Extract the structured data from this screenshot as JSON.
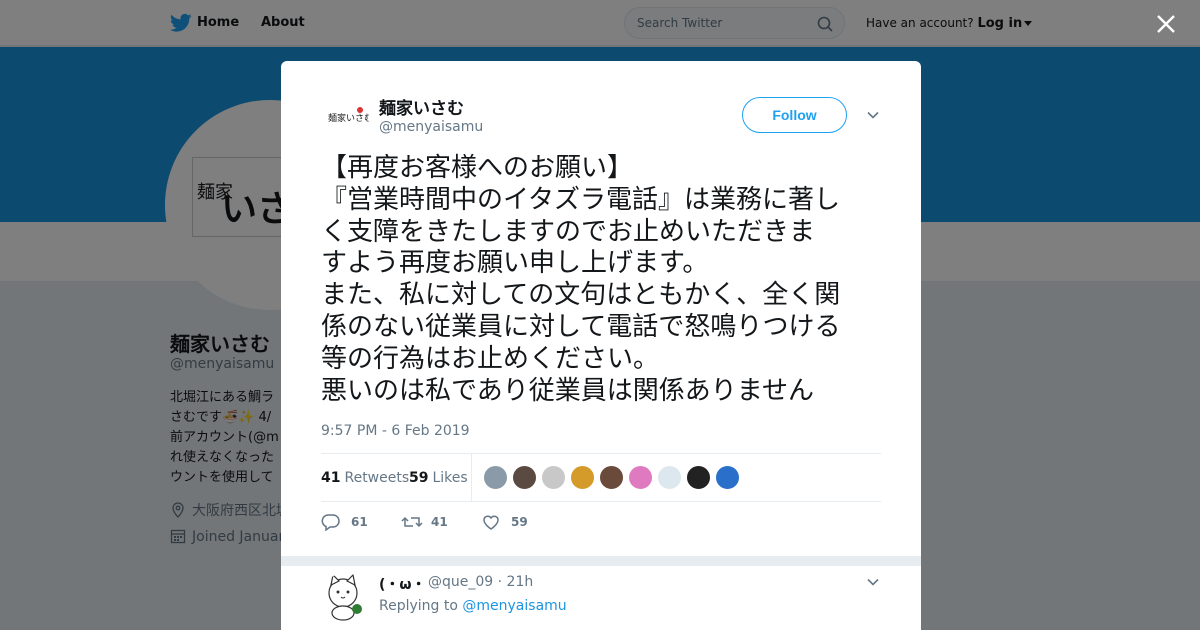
{
  "nav": {
    "home": "Home",
    "about": "About",
    "search_placeholder": "Search Twitter",
    "account_prompt": "Have an account?",
    "login": "Log in"
  },
  "profile": {
    "avatar_text_small": "麺家",
    "avatar_text_large": "いさ",
    "name": "麺家いさむ",
    "handle": "@menyaisamu",
    "bio_lines": [
      "北堀江にある鯛ラ",
      "さむです🍜✨ 4/",
      "前アカウント(@m",
      "れ使えなくなった",
      "ウントを使用して"
    ],
    "bio_mention": "@m",
    "location": "大阪府西区北堀",
    "joined": "Joined Januar"
  },
  "tweet": {
    "name": "麺家いさむ",
    "handle": "@menyaisamu",
    "follow": "Follow",
    "text_lines": [
      "【再度お客様へのお願い】",
      "『営業時間中のイタズラ電話』は業務に著し",
      "く支障をきたしますのでお止めいただきま",
      "すよう再度お願い申し上げます。",
      "また、私に対しての文句はともかく、全く関",
      "係のない従業員に対して電話で怒鳴りつける",
      "等の行為はお止めください。",
      "悪いのは私であり従業員は関係ありません"
    ],
    "timestamp": "9:57 PM - 6 Feb 2019",
    "retweets_count": "41",
    "retweets_label": "Retweets",
    "likes_count": "59",
    "likes_label": "Likes",
    "actions": {
      "replies": "61",
      "retweets": "41",
      "likes": "59"
    },
    "liker_avatar_colors": [
      "#8a9aa8",
      "#5a4a42",
      "#c8c8c8",
      "#d49a2a",
      "#6a4a3a",
      "#e07ac0",
      "#dde8ee",
      "#222222",
      "#2a6fc9"
    ]
  },
  "reply": {
    "name": "(・ω・",
    "handle": "@que_09",
    "time": "· 21h",
    "replying_to_label": "Replying to",
    "replying_to_handle": "@menyaisamu"
  },
  "colors": {
    "accent": "#1da1f2",
    "banner": "#1b95e0",
    "muted": "#657786"
  }
}
